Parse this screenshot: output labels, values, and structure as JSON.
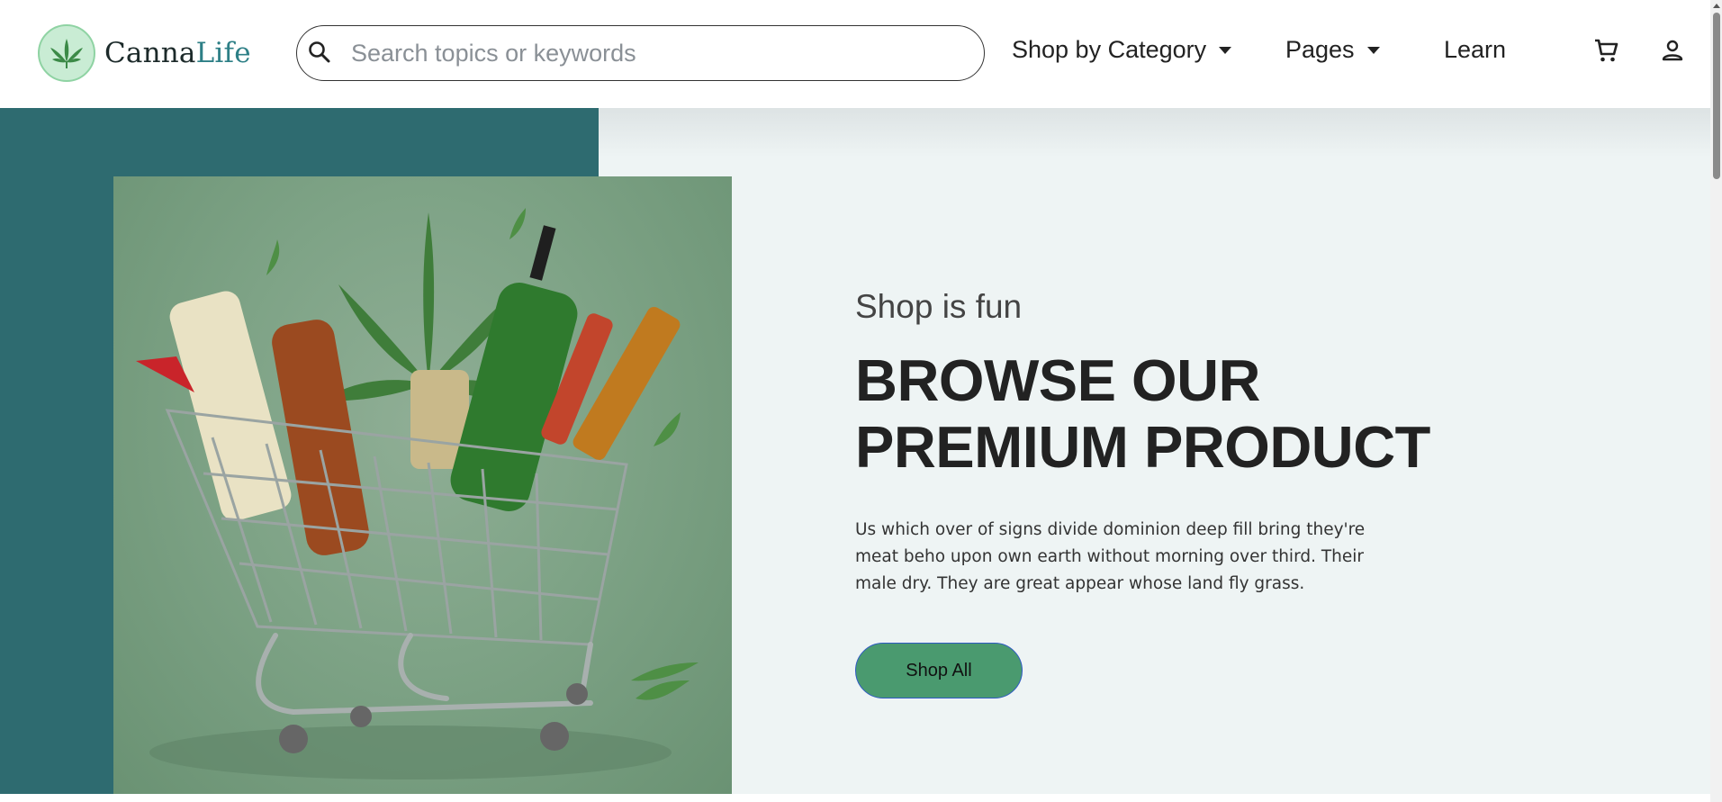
{
  "header": {
    "logo": {
      "part1": "Canna",
      "part2": "Life"
    },
    "search": {
      "placeholder": "Search topics or keywords",
      "value": ""
    },
    "nav": {
      "shop_by_category": "Shop by Category",
      "pages": "Pages",
      "learn": "Learn"
    },
    "icons": {
      "search": "search-icon",
      "cart": "cart-icon",
      "account": "person-icon",
      "logo": "cannabis-leaf-icon"
    }
  },
  "hero": {
    "subtitle": "Shop is fun",
    "headline_line1": "BROWSE OUR",
    "headline_line2": "PREMIUM PRODUCT",
    "description": "Us which over of signs divide dominion deep fill bring they're meat beho upon own earth without morning over third. Their male dry. They are great appear whose land fly grass.",
    "cta_label": "Shop All"
  },
  "colors": {
    "teal_panel": "#2e6b70",
    "hero_bg": "#eef4f4",
    "button_bg": "#4a9a6f",
    "button_border": "#2f5ac4",
    "logo_accent": "#2d7f86"
  }
}
